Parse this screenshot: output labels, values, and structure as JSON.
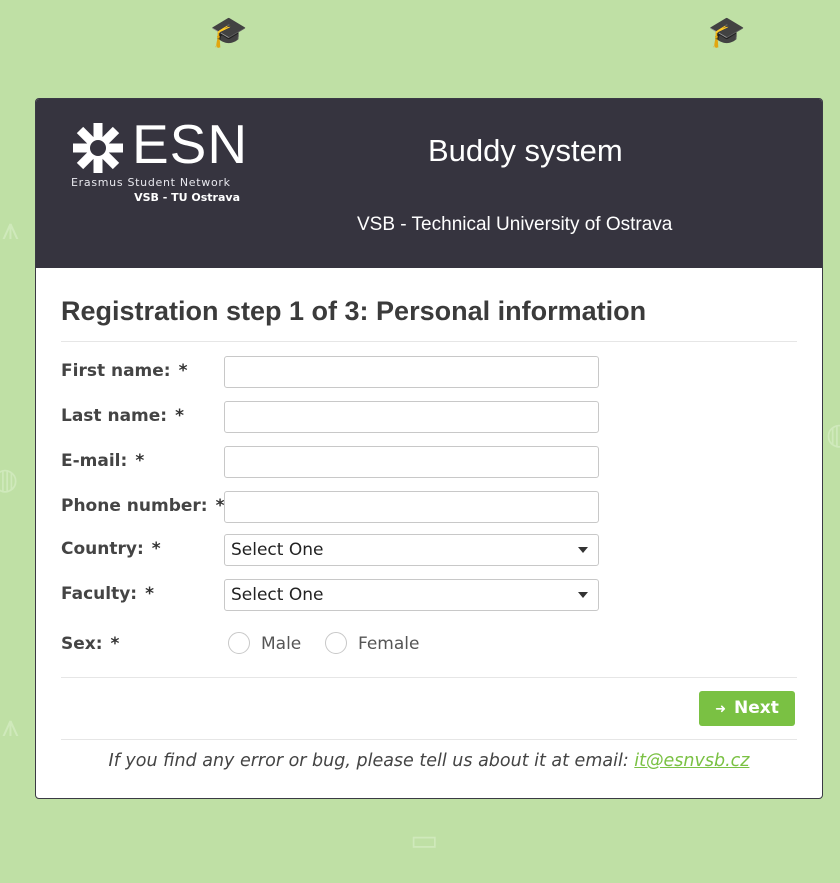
{
  "background": {
    "color": "#bfe0a5",
    "icons": [
      "graduation-cap-icon",
      "bus-icon",
      "compass-icon",
      "globe-icon",
      "building-icon"
    ]
  },
  "header": {
    "logo": {
      "wordmark": "ESN",
      "subtitle": "Erasmus Student Network",
      "section": "VSB - TU Ostrava"
    },
    "title": "Buddy system",
    "subtitle": "VSB - Technical University of Ostrava",
    "background_color": "#36343f"
  },
  "form": {
    "title": "Registration step 1 of 3: Personal information",
    "required_marker": "*",
    "fields": {
      "first_name": {
        "label": "First name:",
        "value": ""
      },
      "last_name": {
        "label": "Last name:",
        "value": ""
      },
      "email": {
        "label": "E-mail:",
        "value": ""
      },
      "phone": {
        "label": "Phone number:",
        "value": ""
      },
      "country": {
        "label": "Country:",
        "value": "Select One"
      },
      "faculty": {
        "label": "Faculty:",
        "value": "Select One"
      },
      "sex": {
        "label": "Sex:",
        "options": [
          "Male",
          "Female"
        ],
        "selected": null
      }
    },
    "next_button": {
      "label": "Next",
      "icon": "arrow-right-icon",
      "color": "#7ac143"
    }
  },
  "footer": {
    "text": "If you find any error or bug, please tell us about it at email: ",
    "email": "it@esnvsb.cz",
    "link_color": "#7ac143"
  }
}
